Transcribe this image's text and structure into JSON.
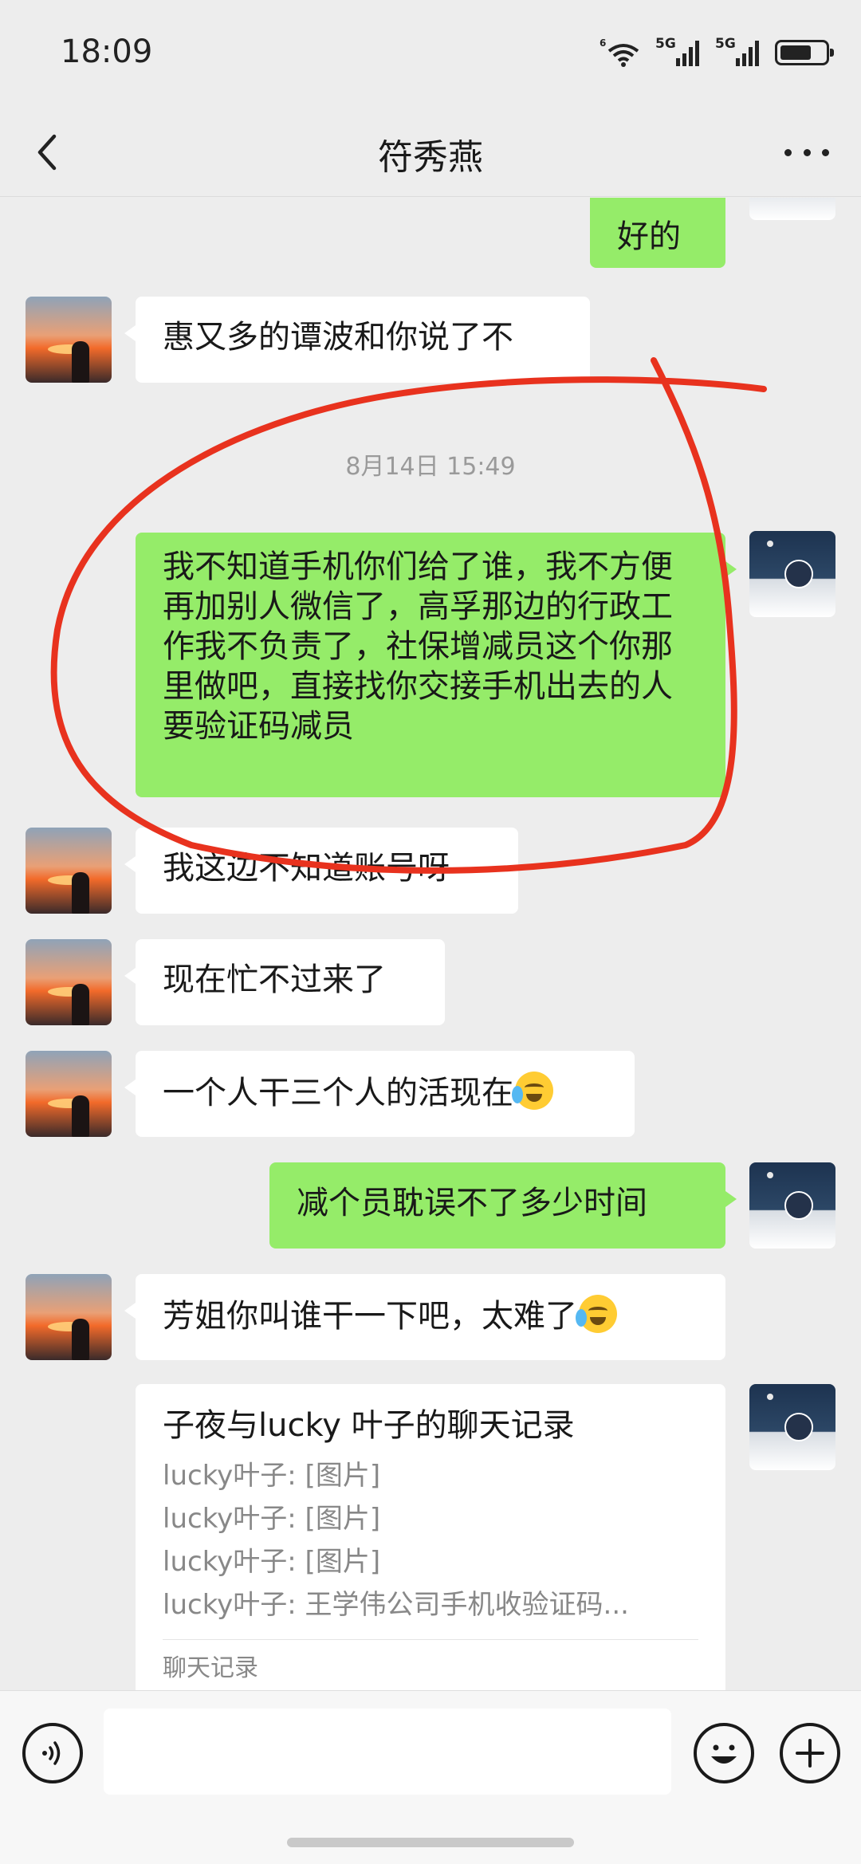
{
  "status_bar": {
    "time": "18:09",
    "wifi_label": "6",
    "sim1_label": "5G",
    "sim2_label": "5G",
    "battery_level": 0.7
  },
  "header": {
    "title": "符秀燕"
  },
  "messages": [
    {
      "side": "out",
      "text": "好的"
    },
    {
      "side": "in",
      "text": "惠又多的谭波和你说了不"
    },
    {
      "side": "in",
      "text": "我这边不知道账号呀"
    },
    {
      "side": "in",
      "text": "现在忙不过来了"
    },
    {
      "side": "in",
      "text": "一个人干三个人的活现在",
      "emoji": "sweat-laugh"
    },
    {
      "side": "out",
      "text": "减个员耽误不了多少时间"
    },
    {
      "side": "in",
      "text": "芳姐你叫谁干一下吧，太难了",
      "emoji": "crying"
    }
  ],
  "timestamp": "8月14日 15:49",
  "long_message": "我不知道手机你们给了谁，我不方便再加别人微信了，高孚那边的行政工作我不负责了，社保增减员这个你那里做吧，直接找你交接手机出去的人要验证码减员",
  "chat_record": {
    "title": "子夜与lucky 叶子的聊天记录",
    "lines": [
      "lucky叶子: [图片]",
      "lucky叶子: [图片]",
      "lucky叶子: [图片]",
      "lucky叶子: 王学伟公司手机收验证码..."
    ],
    "footer": "聊天记录"
  },
  "colors": {
    "background": "#ededed",
    "outgoing_bubble": "#95ec69",
    "incoming_bubble": "#ffffff",
    "annotation_stroke": "#e8321e"
  },
  "input_bar": {
    "value": ""
  }
}
